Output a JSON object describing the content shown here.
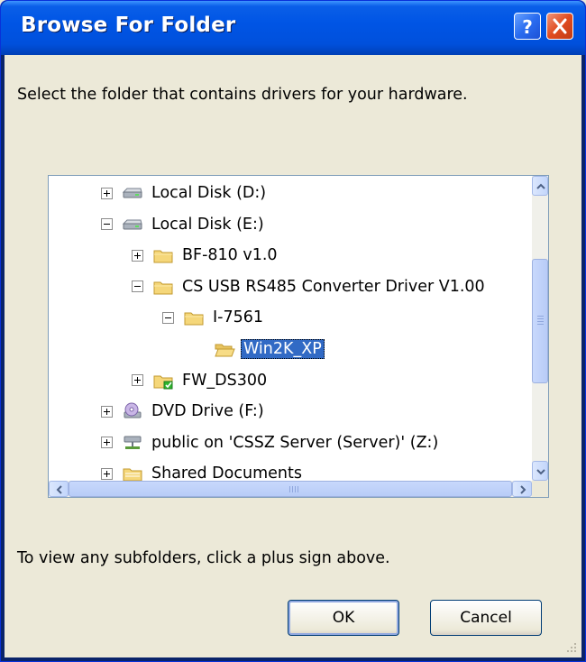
{
  "window": {
    "title": "Browse For Folder",
    "prompt": "Select the folder that contains drivers for your hardware.",
    "hint": "To view any subfolders, click a plus sign above."
  },
  "tree": {
    "items": [
      {
        "label": "Local Disk (D:)",
        "icon": "drive-icon",
        "expander": "plus"
      },
      {
        "label": "Local Disk (E:)",
        "icon": "drive-icon",
        "expander": "minus"
      },
      {
        "label": "BF-810 v1.0",
        "icon": "folder-icon",
        "expander": "plus"
      },
      {
        "label": "CS USB RS485 Converter Driver V1.00",
        "icon": "folder-icon",
        "expander": "minus"
      },
      {
        "label": "I-7561",
        "icon": "folder-icon",
        "expander": "minus"
      },
      {
        "label": "Win2K_XP",
        "icon": "folder-open-icon",
        "expander": "none",
        "selected": true
      },
      {
        "label": "FW_DS300",
        "icon": "folder-shared-icon",
        "expander": "plus"
      },
      {
        "label": "DVD Drive (F:)",
        "icon": "dvd-drive-icon",
        "expander": "plus"
      },
      {
        "label": "public on 'CSSZ Server (Server)' (Z:)",
        "icon": "network-drive-icon",
        "expander": "plus"
      },
      {
        "label": "Shared Documents",
        "icon": "shared-folder-icon",
        "expander": "plus"
      }
    ]
  },
  "buttons": {
    "ok": "OK",
    "cancel": "Cancel"
  },
  "colors": {
    "titlebar": "#0055e5",
    "selection": "#316ac5",
    "dialog_bg": "#ece9d8"
  }
}
